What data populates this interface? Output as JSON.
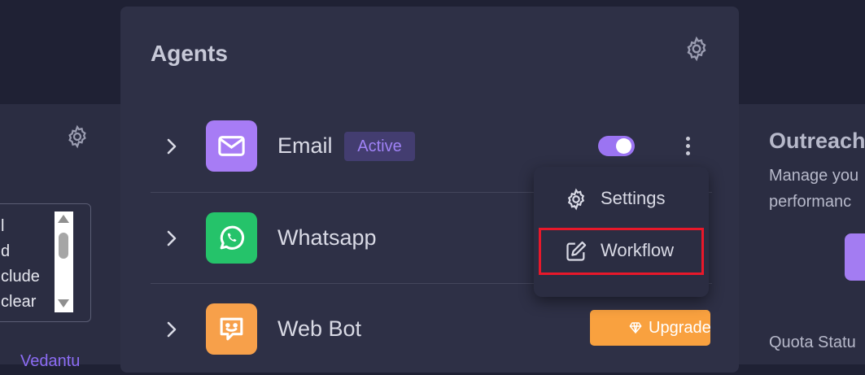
{
  "left_card": {
    "textbox_lines": [
      "l",
      "d",
      "clude",
      "clear"
    ],
    "link_text": "Vedantu"
  },
  "panel": {
    "title": "Agents",
    "agents": [
      {
        "name": "Email",
        "badge": "Active",
        "toggle_on": true,
        "icon": "mail-icon",
        "tile_color": "#a77cf5"
      },
      {
        "name": "Whatsapp",
        "icon": "whatsapp-icon",
        "tile_color": "#25c36a"
      },
      {
        "name": "Web Bot",
        "icon": "chat-bot-icon",
        "tile_color": "#f7a04a",
        "action_label": "Upgrade"
      }
    ]
  },
  "context_menu": {
    "items": [
      {
        "label": "Settings",
        "icon": "gear-icon"
      },
      {
        "label": "Workflow",
        "icon": "edit-icon",
        "highlighted": true
      }
    ]
  },
  "right_card": {
    "title": "Outreach",
    "subtitle": "Manage you\nperformanc",
    "quota_label": "Quota Statu"
  },
  "colors": {
    "accent": "#9b74f2",
    "badge_text": "#9f82f6",
    "upgrade": "#f9a13f",
    "highlight": "#e8182a"
  }
}
